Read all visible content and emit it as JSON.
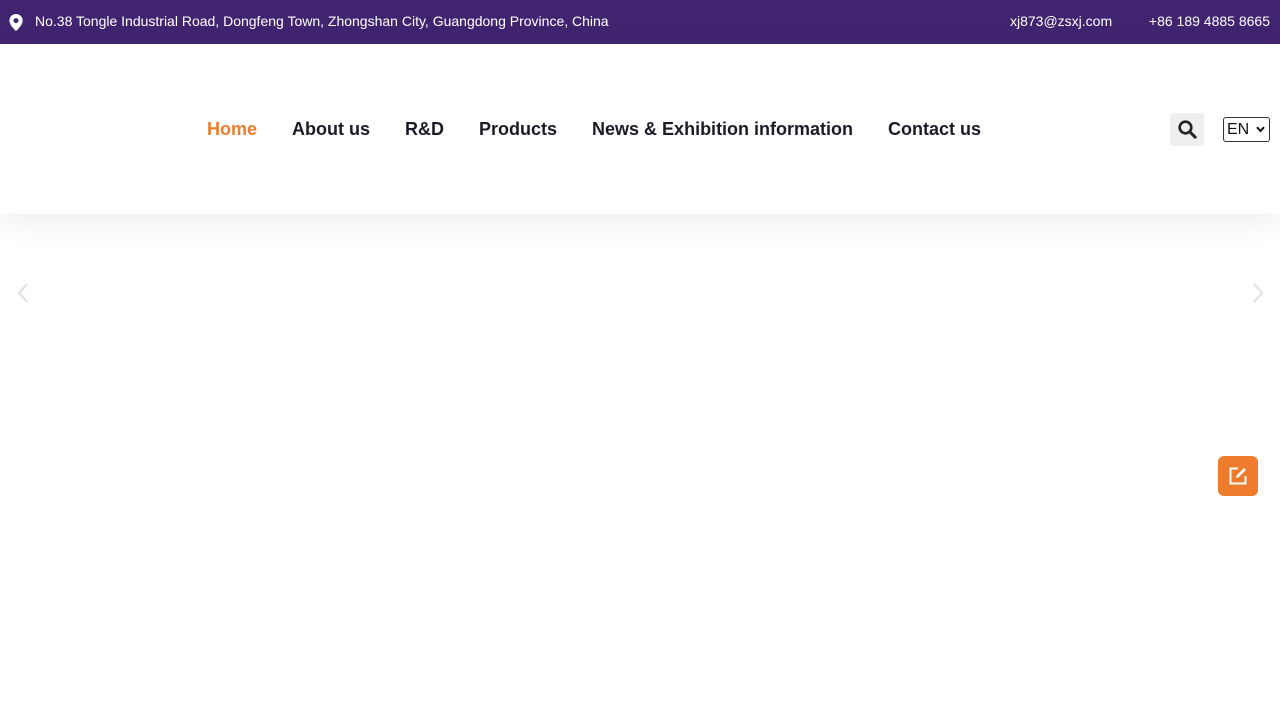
{
  "topbar": {
    "address": "No.38 Tongle Industrial Road, Dongfeng Town, Zhongshan City, Guangdong Province, China",
    "email": "xj873@zsxj.com",
    "phone": "+86 189 4885 8665",
    "background_color": "#402470",
    "icon": "location-pin-icon"
  },
  "nav": {
    "items": [
      {
        "label": "Home",
        "active": true
      },
      {
        "label": "About us"
      },
      {
        "label": "R&D"
      },
      {
        "label": "Products"
      },
      {
        "label": "News & Exhibition information"
      },
      {
        "label": "Contact us"
      }
    ],
    "active_color": "#ee7c2c",
    "text_color": "#1b1b28"
  },
  "header_tools": {
    "search_icon": "search-icon",
    "language": {
      "selected": "EN"
    }
  },
  "slider": {
    "prev_icon": "chevron-left-icon",
    "next_icon": "chevron-right-icon"
  },
  "floating": {
    "icon": "edit-icon",
    "color": "#ee7c2c"
  }
}
